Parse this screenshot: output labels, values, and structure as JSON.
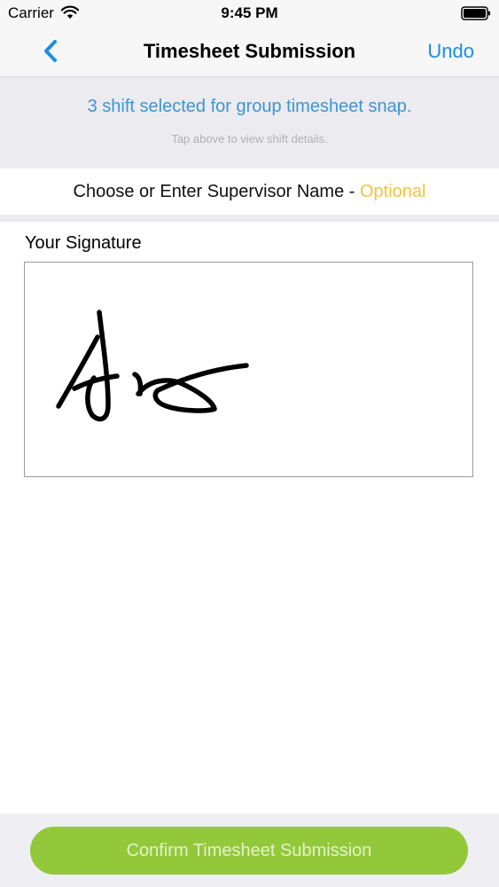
{
  "status_bar": {
    "carrier": "Carrier",
    "time": "9:45 PM",
    "wifi_icon": "wifi-icon",
    "battery_icon": "battery-icon"
  },
  "nav": {
    "back_icon": "chevron-left-icon",
    "title": "Timesheet Submission",
    "undo_label": "Undo"
  },
  "shift_panel": {
    "summary": "3 shift selected for group timesheet snap.",
    "hint": "Tap above to view shift details."
  },
  "supervisor": {
    "prompt": "Choose or Enter Supervisor Name - ",
    "optional_label": "Optional"
  },
  "signature": {
    "label": "Your Signature"
  },
  "footer": {
    "confirm_label": "Confirm Timesheet Submission"
  },
  "colors": {
    "accent_blue": "#1b8ee8",
    "optional_yellow": "#f2c43a",
    "confirm_green": "#93c83b"
  }
}
